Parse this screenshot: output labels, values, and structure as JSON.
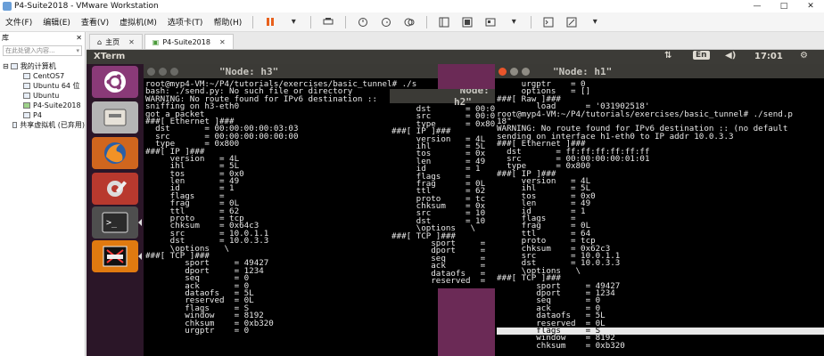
{
  "window": {
    "title": "P4-Suite2018 - VMware Workstation",
    "controls": [
      "—",
      "□",
      "✕"
    ]
  },
  "menu": [
    "文件(F)",
    "编辑(E)",
    "查看(V)",
    "虚拟机(M)",
    "选项卡(T)",
    "帮助(H)"
  ],
  "toolbar_icons": [
    "pause-icon",
    "send-keys-icon",
    "snapshot-icon",
    "revert-icon",
    "manage-snapshot-icon",
    "fit-guest-icon",
    "unity-icon",
    "fullscreen-icon",
    "console-icon",
    "stretch-icon"
  ],
  "library": {
    "title": "库",
    "close": "✕",
    "search_placeholder": "在此处键入内容...",
    "items": [
      {
        "label": "我的计算机",
        "depth": 0
      },
      {
        "label": "CentOS7",
        "depth": 1
      },
      {
        "label": "Ubuntu 64 位",
        "depth": 1
      },
      {
        "label": "Ubuntu",
        "depth": 1
      },
      {
        "label": "P4-Suite2018",
        "depth": 1
      },
      {
        "label": "P4",
        "depth": 1
      },
      {
        "label": "共享虚拟机 (已弃用)",
        "depth": 0
      }
    ]
  },
  "tabs": [
    {
      "label": "主页",
      "active": false
    },
    {
      "label": "P4-Suite2018",
      "active": true
    }
  ],
  "ubuntu_bar": {
    "app_name": "XTerm",
    "keyboard": "En",
    "time": "17:01"
  },
  "launcher": [
    "ubuntu-icon",
    "files-icon",
    "firefox-icon",
    "settings-icon",
    "terminal-icon",
    "xterm-icon"
  ],
  "terminal_h3": {
    "title": "\"Node: h3\"",
    "lines": [
      "root@myp4-VM:~/P4/tutorials/exercises/basic_tunnel# ./s",
      "bash: ./send.py: No such file or directory",
      "WARNING: No route found for IPv6 destination ::",
      "sniffing on h3-eth0",
      "got a packet",
      "###[ Ethernet ]###",
      "  dst       = 00:00:00:00:03:03",
      "  src       = 00:00:00:00:00:00",
      "  type      = 0x800",
      "###[ IP ]###",
      "     version   = 4L",
      "     ihl       = 5L",
      "     tos       = 0x0",
      "     len       = 49",
      "     id        = 1",
      "     flags     =",
      "     frag      = 0L",
      "     ttl       = 62",
      "     proto     = tcp",
      "     chksum    = 0x64c3",
      "     src       = 10.0.1.1",
      "     dst       = 10.0.3.3",
      "     \\options   \\",
      "###[ TCP ]###",
      "        sport     = 49427",
      "        dport     = 1234",
      "        seq       = 0",
      "        ack       = 0",
      "        dataofs   = 5L",
      "        reserved  = 0L",
      "        flags     = S",
      "        window    = 8192",
      "        chksum    = 0xb320",
      "        urgptr    = 0"
    ]
  },
  "terminal_h2": {
    "title": "\"Node: h2\"",
    "lines": [
      "     dst       = 00:00",
      "     src       = 00:00",
      "     type      = 0x800",
      "###[ IP ]###",
      "     version   = 4L",
      "     ihl       = 5L",
      "     tos       = 0x",
      "     len       = 49",
      "     id        = 1",
      "     flags     =",
      "     frag      = 0L",
      "     ttl       = 62",
      "     proto     = tc",
      "     chksum    = 0x",
      "     src       = 10",
      "     dst       = 10",
      "     \\options   \\",
      "###[ TCP ]###",
      "        sport     =",
      "        dport     =",
      "        seq       =",
      "        ack       =",
      "        dataofs   =",
      "        reserved  ="
    ]
  },
  "terminal_h1": {
    "title": "\"Node: h1\"",
    "highlight_line": 33,
    "lines": [
      "     urgptr    = 0",
      "     options   = []",
      "###[ Raw ]###",
      "        load      = '031902518'",
      "root@myp4-VM:~/P4/tutorials/exercises/basic_tunnel# ./send.p",
      "18\"",
      "WARNING: No route found for IPv6 destination :: (no default",
      "sending on interface h1-eth0 to IP addr 10.0.3.3",
      "###[ Ethernet ]###",
      "  dst       = ff:ff:ff:ff:ff:ff",
      "  src       = 00:00:00:00:01:01",
      "  type      = 0x800",
      "###[ IP ]###",
      "     version   = 4L",
      "     ihl       = 5L",
      "     tos       = 0x0",
      "     len       = 49",
      "     id        = 1",
      "     flags     =",
      "     frag      = 0L",
      "     ttl       = 64",
      "     proto     = tcp",
      "     chksum    = 0x62c3",
      "     src       = 10.0.1.1",
      "     dst       = 10.0.3.3",
      "     \\options   \\",
      "###[ TCP ]###",
      "        sport     = 49427",
      "        dport     = 1234",
      "        seq       = 0",
      "        ack       = 0",
      "        dataofs   = 5L",
      "        reserved  = 0L",
      "        flags     = S",
      "        window    = 8192",
      "        chksum    = 0xb320"
    ]
  },
  "colors": {
    "desktop": "#6b2a56",
    "launcher": "#2b1628",
    "terminal_bg": "#000000",
    "close_dot": "#e9552b"
  }
}
